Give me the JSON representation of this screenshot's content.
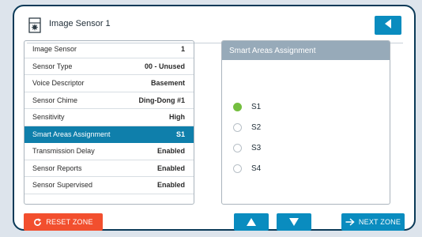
{
  "header": {
    "title": "Image Sensor 1",
    "icon": "image-sensor-icon",
    "back_icon": "back-arrow-icon"
  },
  "zone_properties": [
    {
      "label": "Image Sensor",
      "value": "1"
    },
    {
      "label": "Sensor Type",
      "value": "00 - Unused"
    },
    {
      "label": "Voice Descriptor",
      "value": "Basement"
    },
    {
      "label": "Sensor Chime",
      "value": "Ding-Dong #1"
    },
    {
      "label": "Sensitivity",
      "value": "High"
    },
    {
      "label": "Smart Areas Assignment",
      "value": "S1",
      "selected": true
    },
    {
      "label": "Transmission Delay",
      "value": "Enabled"
    },
    {
      "label": "Sensor Reports",
      "value": "Enabled"
    },
    {
      "label": "Sensor Supervised",
      "value": "Enabled"
    }
  ],
  "smart_areas": {
    "title": "Smart Areas Assignment",
    "options": [
      {
        "label": "S1",
        "checked": true
      },
      {
        "label": "S2",
        "checked": false
      },
      {
        "label": "S3",
        "checked": false
      },
      {
        "label": "S4",
        "checked": false
      }
    ]
  },
  "footer": {
    "reset_label": "RESET ZONE",
    "next_label": "NEXT ZONE"
  },
  "colors": {
    "accent": "#0a8cbf",
    "selected_row": "#0f7fab",
    "danger": "#f24f2e",
    "checked": "#74be3f",
    "panel_header": "#97aab9",
    "frame": "#0b3a58"
  }
}
